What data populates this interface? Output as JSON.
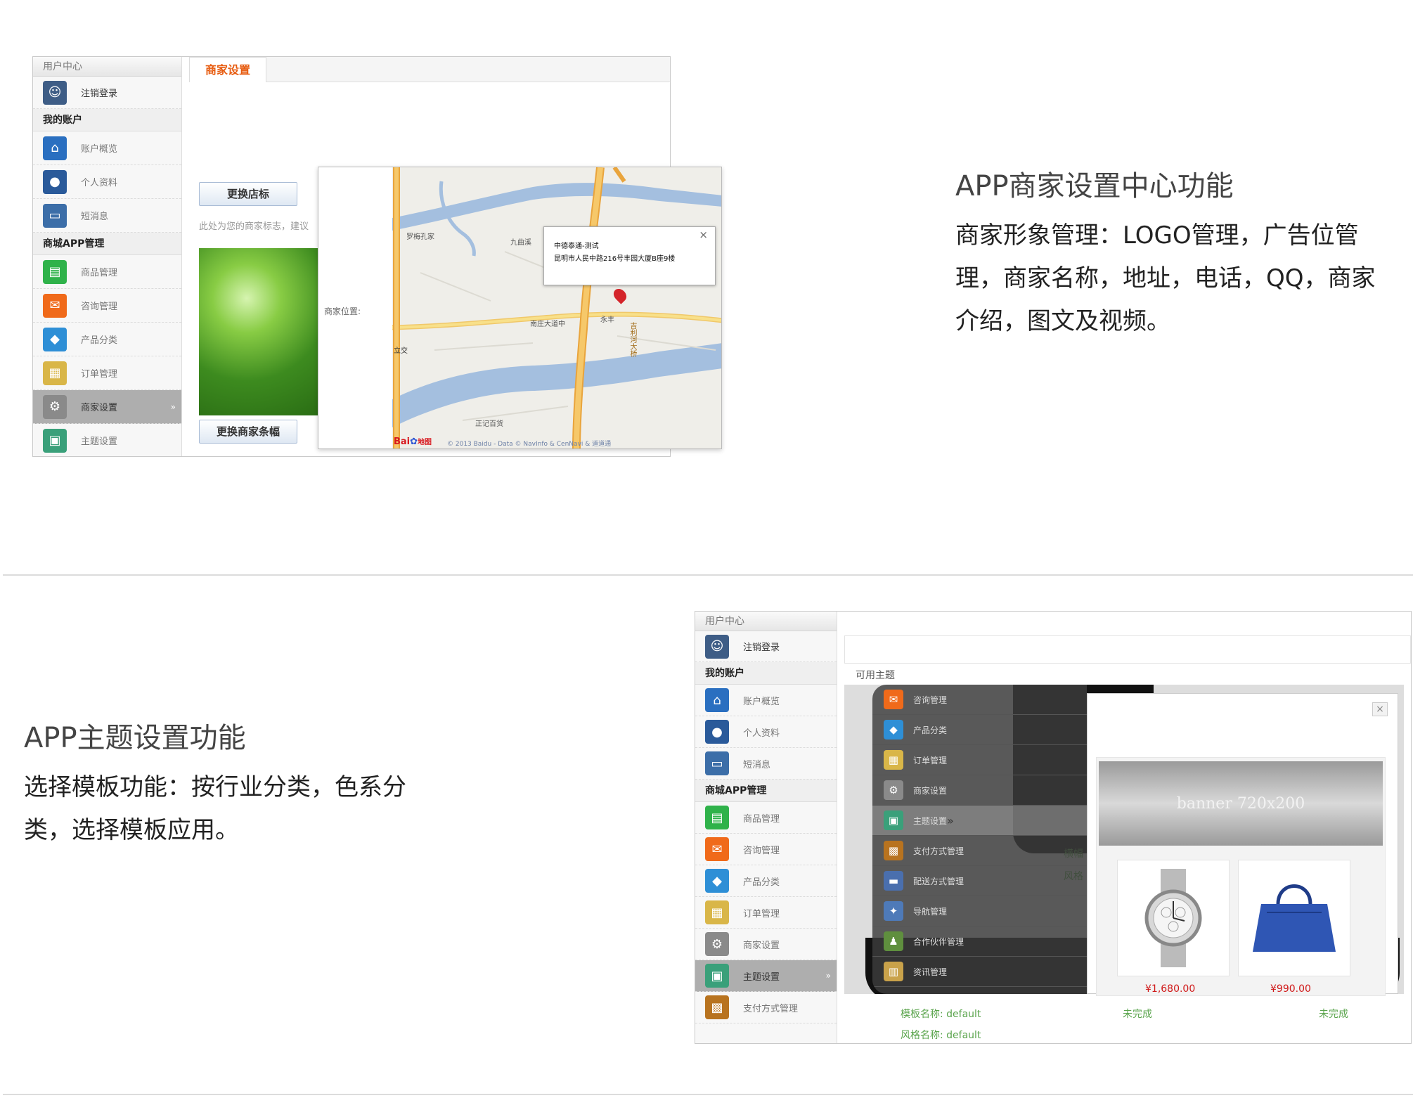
{
  "section1": {
    "sidebar": {
      "header": "用户中心",
      "logout": "注销登录",
      "section_my_account": "我的账户",
      "account_items": [
        {
          "label": "账户概览",
          "icon": "house-icon"
        },
        {
          "label": "个人资料",
          "icon": "user-info-icon"
        },
        {
          "label": "短消息",
          "icon": "message-icon"
        }
      ],
      "section_app": "商城APP管理",
      "app_items": [
        {
          "label": "商品管理",
          "icon": "goods-icon"
        },
        {
          "label": "咨询管理",
          "icon": "chat-icon"
        },
        {
          "label": "产品分类",
          "icon": "category-icon"
        },
        {
          "label": "订单管理",
          "icon": "order-icon"
        },
        {
          "label": "商家设置",
          "icon": "settings-icon"
        },
        {
          "label": "主题设置",
          "icon": "theme-icon"
        }
      ]
    },
    "tab": "商家设置",
    "change_logo_button": "更换店标",
    "hint_text": "此处为您的商家标志，建议",
    "change_banner_button": "更换商家条幅",
    "map": {
      "field_label": "商家位置:",
      "popup_title": "中德泰通-测试",
      "popup_address": "昆明市人民中路216号丰园大厦B座9楼",
      "close": "×",
      "place_labels": [
        "罗梅孔家",
        "九曲溪",
        "南庄大道中",
        "永丰",
        "立交",
        "正记百货",
        "吉利河大桥"
      ],
      "logo": "Bai",
      "logo_suffix": "地图",
      "copyright": "© 2013 Baidu - Data © NavInfo & CenNavi & 道道通"
    },
    "title": "APP商家设置中心功能",
    "description": "商家形象管理：LOGO管理，广告位管理，商家名称，地址，电话，QQ，商家介绍，图文及视频。"
  },
  "section2": {
    "sidebar": {
      "header": "用户中心",
      "logout": "注销登录",
      "section_my_account": "我的账户",
      "account_items": [
        {
          "label": "账户概览",
          "icon": "house-icon"
        },
        {
          "label": "个人资料",
          "icon": "user-info-icon"
        },
        {
          "label": "短消息",
          "icon": "message-icon"
        }
      ],
      "section_app": "商城APP管理",
      "app_items": [
        {
          "label": "商品管理",
          "icon": "goods-icon"
        },
        {
          "label": "咨询管理",
          "icon": "chat-icon"
        },
        {
          "label": "产品分类",
          "icon": "category-icon"
        },
        {
          "label": "订单管理",
          "icon": "order-icon"
        },
        {
          "label": "商家设置",
          "icon": "settings-icon"
        },
        {
          "label": "主题设置",
          "icon": "theme-icon"
        },
        {
          "label": "支付方式管理",
          "icon": "payment-icon"
        }
      ]
    },
    "available_themes": "可用主题",
    "overlay_menu": [
      {
        "label": "咨询管理",
        "icon": "chat-icon"
      },
      {
        "label": "产品分类",
        "icon": "category-icon"
      },
      {
        "label": "订单管理",
        "icon": "order-icon"
      },
      {
        "label": "商家设置",
        "icon": "settings-icon"
      },
      {
        "label": "主题设置",
        "icon": "theme-icon"
      },
      {
        "label": "支付方式管理",
        "icon": "payment-icon"
      },
      {
        "label": "配送方式管理",
        "icon": "truck-icon"
      },
      {
        "label": "导航管理",
        "icon": "nav-icon"
      },
      {
        "label": "合作伙伴管理",
        "icon": "partner-icon"
      },
      {
        "label": "资讯管理",
        "icon": "news-icon"
      }
    ],
    "preview": {
      "close": "×",
      "banner": "banner 720x200",
      "price1": "¥1,680.00",
      "price2": "¥990.00"
    },
    "behind_text": [
      "横幅",
      "风格"
    ],
    "template_name": "模板名称: default",
    "style_name": "风格名称: default",
    "status1": "未完成",
    "status2": "未完成",
    "title": "APP主题设置功能",
    "description": "选择模板功能：按行业分类，色系分类，选择模板应用。"
  },
  "colors": {
    "accent": "#e75b0f",
    "status_green": "#5aa44c"
  }
}
